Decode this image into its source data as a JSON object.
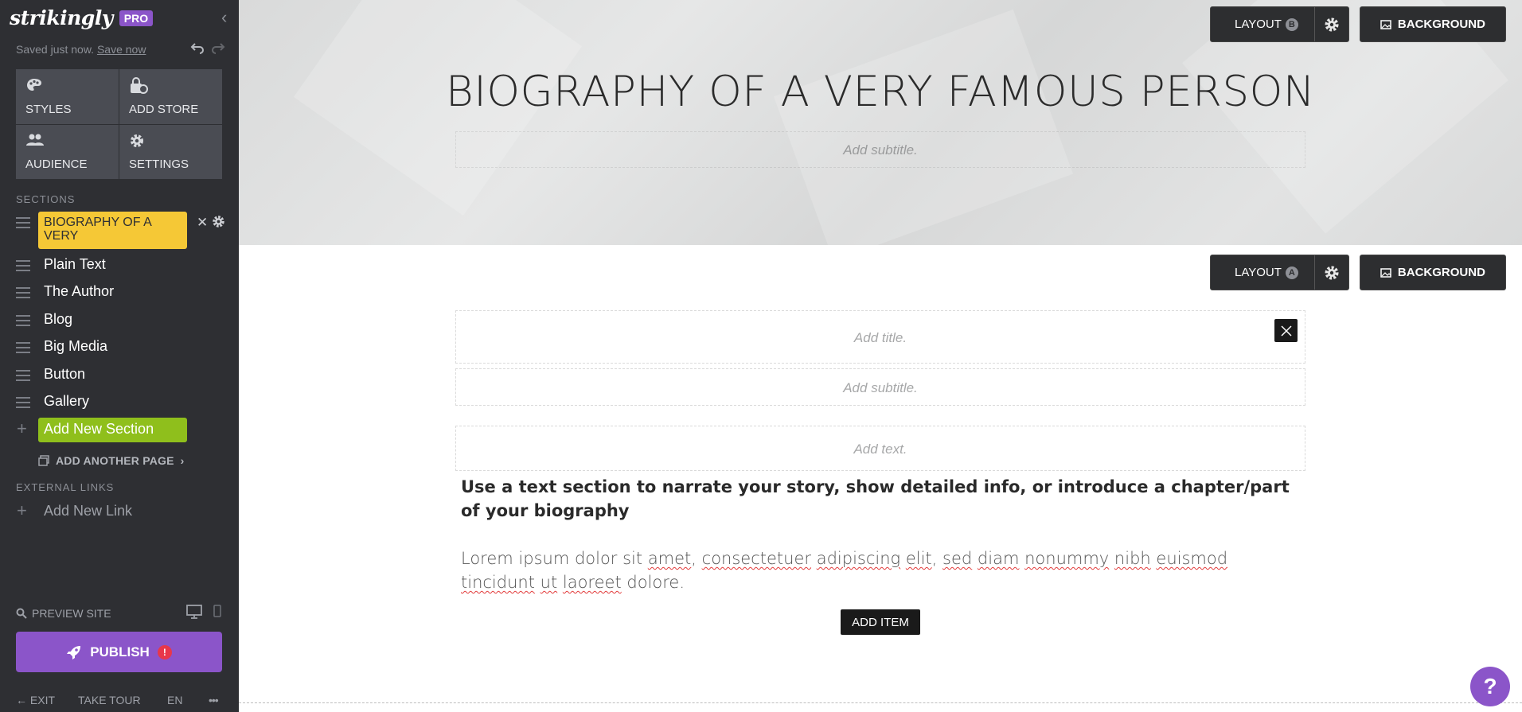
{
  "brand": {
    "logo": "strikingly",
    "badge": "PRO"
  },
  "status": {
    "saved": "Saved just now.",
    "save_now": "Save now"
  },
  "tools": [
    {
      "label": "STYLES",
      "icon": "palette-icon"
    },
    {
      "label": "ADD STORE",
      "icon": "store-icon"
    },
    {
      "label": "AUDIENCE",
      "icon": "people-icon"
    },
    {
      "label": "SETTINGS",
      "icon": "gear-icon"
    }
  ],
  "sections": {
    "heading": "SECTIONS",
    "active": "BIOGRAPHY OF A VERY",
    "items": [
      "Plain Text",
      "The Author",
      "Blog",
      "Big Media",
      "Button",
      "Gallery"
    ],
    "add_new": "Add New Section",
    "add_page": "ADD ANOTHER PAGE"
  },
  "external": {
    "heading": "EXTERNAL LINKS",
    "add_link": "Add New Link"
  },
  "preview": {
    "label": "PREVIEW SITE"
  },
  "publish": {
    "label": "PUBLISH",
    "alert": "!"
  },
  "footer": {
    "exit": "EXIT",
    "tour": "TAKE TOUR",
    "lang": "EN",
    "more": "•••"
  },
  "hero": {
    "title": "BIOGRAPHY OF A VERY FAMOUS PERSON",
    "subtitle_placeholder": "Add subtitle.",
    "layout_label": "LAYOUT",
    "layout_letter": "B",
    "background_label": "BACKGROUND"
  },
  "text_section": {
    "layout_label": "LAYOUT",
    "layout_letter": "A",
    "background_label": "BACKGROUND",
    "title_placeholder": "Add title.",
    "subtitle_placeholder": "Add subtitle.",
    "text_placeholder": "Add text.",
    "heading": "Use a text section to narrate your story, show detailed info, or introduce a chapter/part of your biography",
    "body_parts": [
      "Lorem ipsum dolor sit ",
      "amet",
      ", ",
      "consectetuer",
      " ",
      "adipiscing",
      " ",
      "elit",
      ", ",
      "sed",
      " ",
      "diam",
      " ",
      "nonummy",
      " ",
      "nibh",
      " ",
      "euismod",
      " ",
      "tincidunt",
      " ",
      "ut",
      " ",
      "laoreet",
      " dolore."
    ],
    "add_item": "ADD ITEM"
  },
  "help": {
    "label": "?"
  },
  "colors": {
    "sidebar": "#2e2f33",
    "active_section": "#f5c836",
    "add_section": "#8fbf1c",
    "publish": "#8b55c9"
  }
}
